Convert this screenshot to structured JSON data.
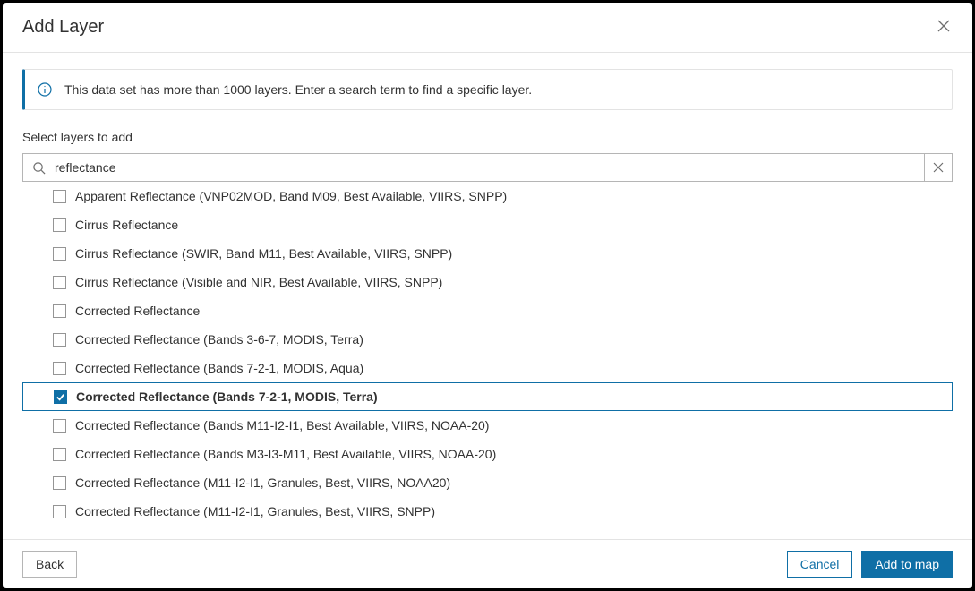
{
  "dialog": {
    "title": "Add Layer",
    "info": "This data set has more than 1000 layers. Enter a search term to find a specific layer.",
    "select_label": "Select layers to add",
    "search_value": "reflectance"
  },
  "layers": [
    {
      "label": "Apparent Reflectance (VNP02MOD, Band M09, Best Available, VIIRS, SNPP)",
      "checked": false
    },
    {
      "label": "Cirrus Reflectance",
      "checked": false
    },
    {
      "label": "Cirrus Reflectance (SWIR, Band M11, Best Available, VIIRS, SNPP)",
      "checked": false
    },
    {
      "label": "Cirrus Reflectance (Visible and NIR, Best Available, VIIRS, SNPP)",
      "checked": false
    },
    {
      "label": "Corrected Reflectance",
      "checked": false
    },
    {
      "label": "Corrected Reflectance (Bands 3-6-7, MODIS, Terra)",
      "checked": false
    },
    {
      "label": "Corrected Reflectance (Bands 7-2-1, MODIS, Aqua)",
      "checked": false
    },
    {
      "label": "Corrected Reflectance (Bands 7-2-1, MODIS, Terra)",
      "checked": true
    },
    {
      "label": "Corrected Reflectance (Bands M11-I2-I1, Best Available, VIIRS, NOAA-20)",
      "checked": false
    },
    {
      "label": "Corrected Reflectance (Bands M3-I3-M11, Best Available, VIIRS, NOAA-20)",
      "checked": false
    },
    {
      "label": "Corrected Reflectance (M11-I2-I1, Granules, Best, VIIRS, NOAA20)",
      "checked": false
    },
    {
      "label": "Corrected Reflectance (M11-I2-I1, Granules, Best, VIIRS, SNPP)",
      "checked": false
    }
  ],
  "footer": {
    "back": "Back",
    "cancel": "Cancel",
    "add": "Add to map"
  }
}
